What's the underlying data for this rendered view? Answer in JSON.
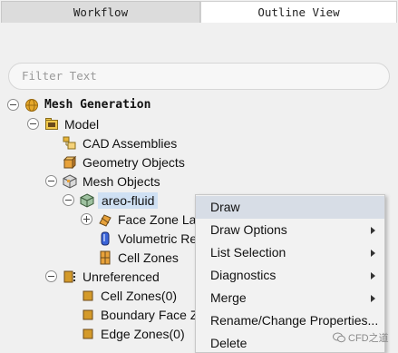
{
  "tabs": {
    "workflow": "Workflow",
    "outline": "Outline View"
  },
  "filter": {
    "placeholder": "Filter Text"
  },
  "tree": {
    "mesh_generation": "Mesh Generation",
    "model": "Model",
    "cad_assemblies": "CAD Assemblies",
    "geometry_objects": "Geometry Objects",
    "mesh_objects": "Mesh Objects",
    "areo_fluid": "areo-fluid",
    "face_zone": "Face Zone La",
    "volumetric": "Volumetric Re",
    "cell_zones": "Cell Zones",
    "unreferenced": "Unreferenced",
    "cell_zones0": "Cell Zones(0)",
    "boundary_face": "Boundary Face Z",
    "edge_zones0": "Edge Zones(0)"
  },
  "context_menu": {
    "draw": "Draw",
    "draw_options": "Draw Options",
    "list_selection": "List Selection",
    "diagnostics": "Diagnostics",
    "merge": "Merge",
    "rename": "Rename/Change Properties...",
    "delete": "Delete"
  },
  "watermark": "CFD之道",
  "colors": {
    "selection": "#cfe0f3",
    "menu_highlight": "#d7dde6",
    "menu_bg": "#f2f2f2"
  }
}
